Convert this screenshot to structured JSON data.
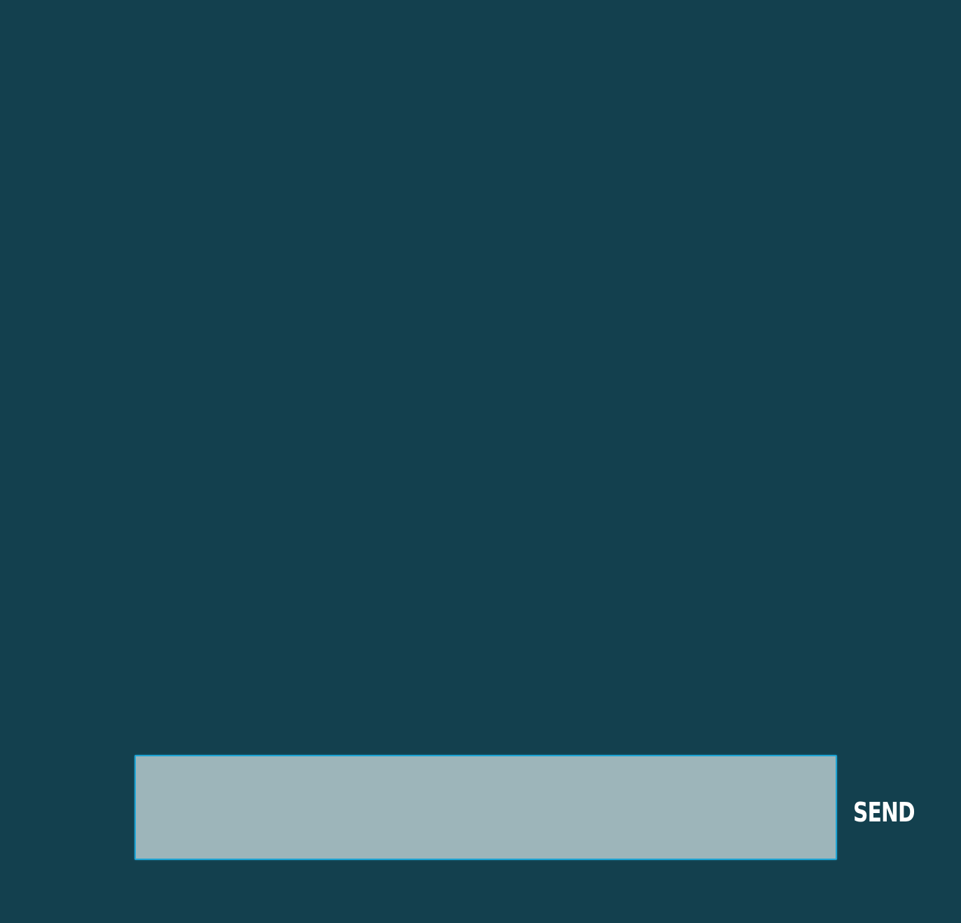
{
  "colors": {
    "background": "#13404e",
    "input_fill": "#9db5ba",
    "input_border": "#1fa6d6",
    "send_text": "#ffffff"
  },
  "composer": {
    "message_value": "",
    "message_placeholder": "",
    "send_label": "SEND"
  }
}
